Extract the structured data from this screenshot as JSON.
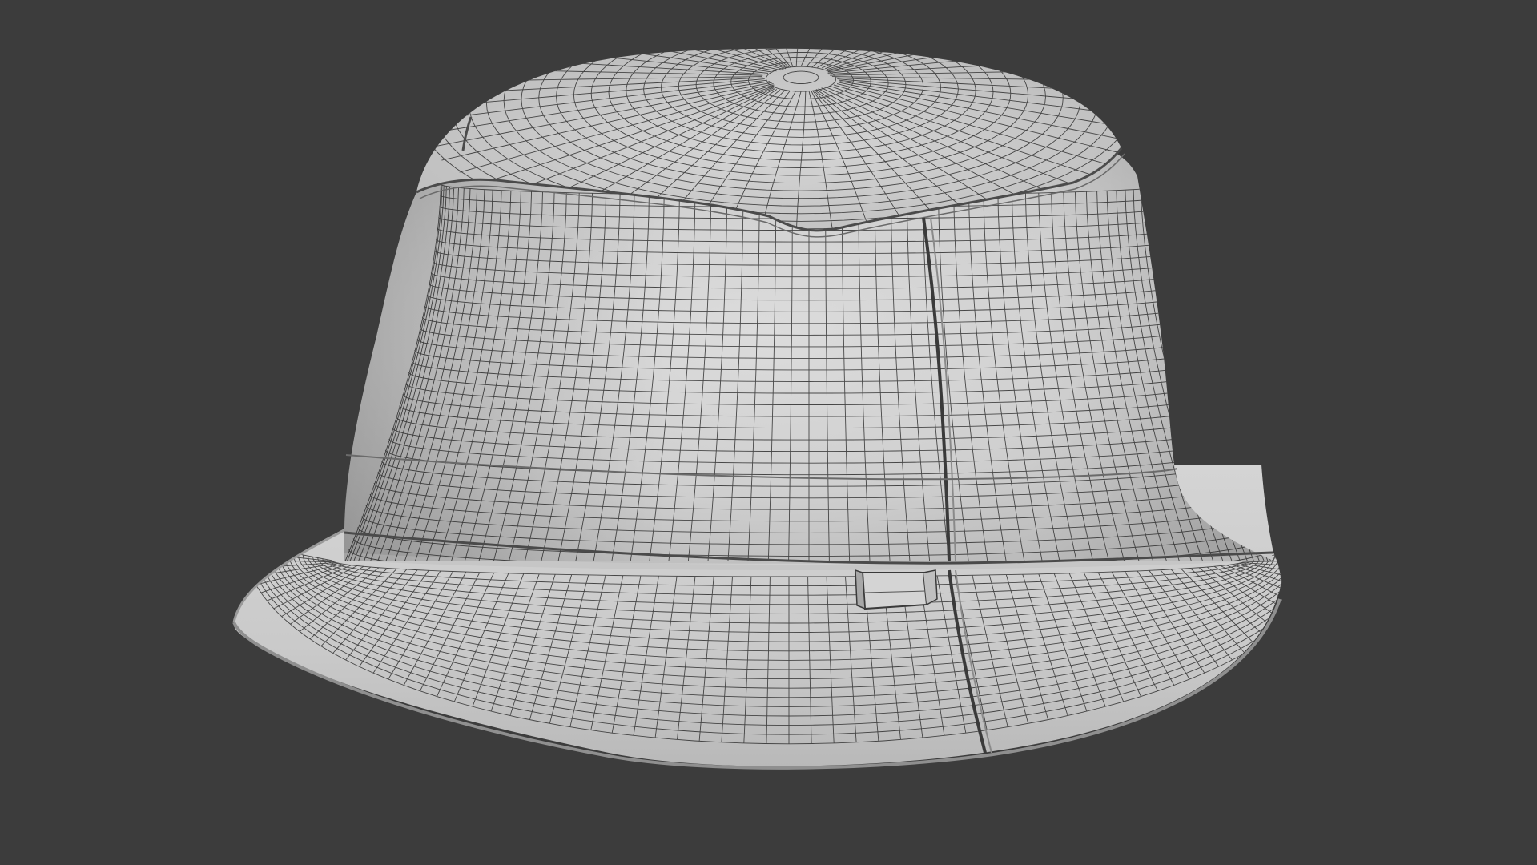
{
  "scene": {
    "subject": "bucket-hat",
    "display_mode": "wireframe-on-shaded",
    "colors": {
      "background": "#3c3c3c",
      "surface_light": "#dedede",
      "surface_mid": "#c4c4c4",
      "surface_shadow": "#a9a9a9",
      "wire": "#2a2a2a",
      "seam": "#555555"
    }
  }
}
